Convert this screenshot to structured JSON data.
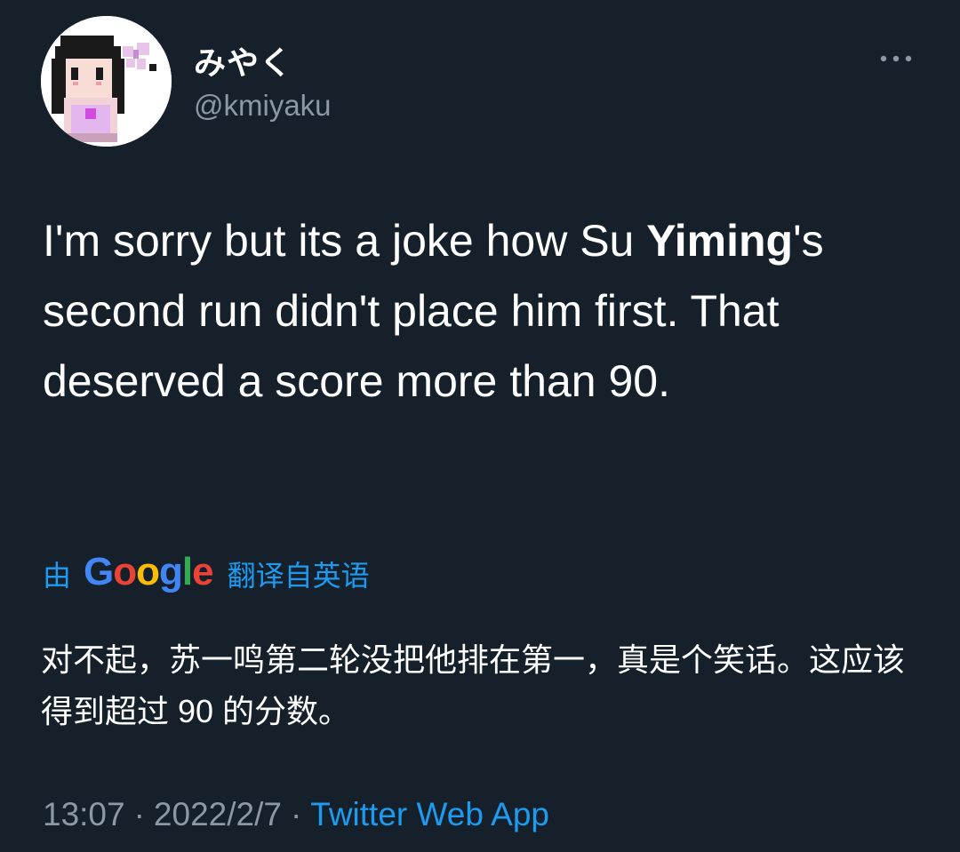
{
  "user": {
    "display_name": "みやく",
    "handle": "@kmiyaku"
  },
  "tweet": {
    "text_part1": "I'm sorry but its a joke how Su ",
    "text_bold": "Yiming",
    "text_part2": "'s second run didn't place him first. That deserved a score more than 90."
  },
  "translation": {
    "prefix": "由",
    "provider_letters": [
      "G",
      "o",
      "o",
      "g",
      "l",
      "e"
    ],
    "provider_colors": [
      "#4285f4",
      "#ea4335",
      "#fbbc05",
      "#4285f4",
      "#34a853",
      "#ea4335"
    ],
    "suffix": "翻译自英语",
    "translated_text": "对不起，苏一鸣第二轮没把他排在第一，真是个笑话。这应该得到超过 90 的分数。"
  },
  "meta": {
    "time": "13:07",
    "separator": "·",
    "date": "2022/2/7",
    "source": "Twitter Web App"
  },
  "icons": {
    "more": "more-horizontal-icon",
    "avatar": "pixel-art-avatar"
  },
  "colors": {
    "background": "#15202b",
    "text": "#ffffff",
    "secondary_text": "#8b98a5",
    "link": "#1d9bf0"
  }
}
